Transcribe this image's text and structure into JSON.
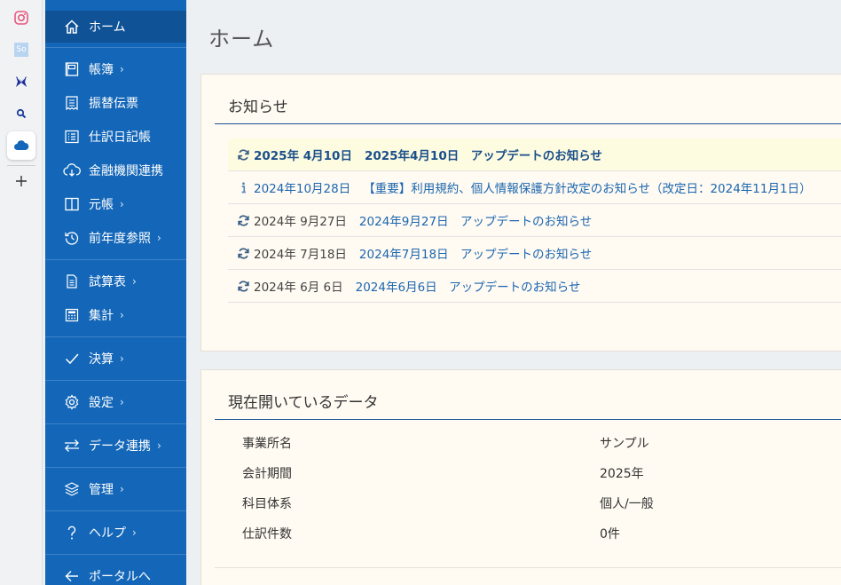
{
  "rail": {
    "items": [
      {
        "icon": "instagram-icon"
      },
      {
        "icon": "so-app-icon",
        "label": "So"
      },
      {
        "icon": "butterfly-icon"
      },
      {
        "icon": "search-icon"
      },
      {
        "icon": "cloud-icon"
      },
      {
        "icon": "plus-icon"
      }
    ]
  },
  "sidebar": {
    "items": [
      {
        "label": "ホーム",
        "icon": "home-icon",
        "chevron": ""
      },
      {
        "label": "帳簿",
        "icon": "ledger-icon",
        "chevron": "›"
      },
      {
        "label": "振替伝票",
        "icon": "receipt-icon",
        "chevron": ""
      },
      {
        "label": "仕訳日記帳",
        "icon": "journal-list-icon",
        "chevron": ""
      },
      {
        "label": "金融機関連携",
        "icon": "cloud-download-icon",
        "chevron": ""
      },
      {
        "label": "元帳",
        "icon": "book-icon",
        "chevron": "›"
      },
      {
        "label": "前年度参照",
        "icon": "history-icon",
        "chevron": "›"
      },
      {
        "label": "試算表",
        "icon": "document-icon",
        "chevron": "›"
      },
      {
        "label": "集計",
        "icon": "calculator-icon",
        "chevron": "›"
      },
      {
        "label": "決算",
        "icon": "check-icon",
        "chevron": "›"
      },
      {
        "label": "設定",
        "icon": "gear-icon",
        "chevron": "›"
      },
      {
        "label": "データ連携",
        "icon": "swap-icon",
        "chevron": "›"
      },
      {
        "label": "管理",
        "icon": "layers-icon",
        "chevron": "›"
      },
      {
        "label": "ヘルプ",
        "icon": "help-icon",
        "chevron": "›"
      },
      {
        "label": "ポータルへ",
        "icon": "arrow-left-icon",
        "chevron": ""
      }
    ]
  },
  "main": {
    "title": "ホーム",
    "news": {
      "title": "お知らせ",
      "items": [
        {
          "icon": "refresh-icon",
          "date": "2025年 4月10日",
          "text": "2025年4月10日　アップデートのお知らせ",
          "highlight": true
        },
        {
          "icon": "info-icon",
          "date": "2024年10月28日",
          "text": "【重要】利用規約、個人情報保護方針改定のお知らせ（改定日：2024年11月1日）",
          "highlight": false
        },
        {
          "icon": "refresh-icon",
          "date": "2024年 9月27日",
          "text": "2024年9月27日　アップデートのお知らせ",
          "highlight": false
        },
        {
          "icon": "refresh-icon",
          "date": "2024年 7月18日",
          "text": "2024年7月18日　アップデートのお知らせ",
          "highlight": false
        },
        {
          "icon": "refresh-icon",
          "date": "2024年 6月 6日",
          "text": "2024年6月6日　アップデートのお知らせ",
          "highlight": false
        }
      ]
    },
    "current_data": {
      "title": "現在開いているデータ",
      "rows": [
        {
          "key": "事業所名",
          "value": "サンプル"
        },
        {
          "key": "会計期間",
          "value": "2025年"
        },
        {
          "key": "科目体系",
          "value": "個人/一般"
        },
        {
          "key": "仕訳件数",
          "value": "0件"
        }
      ]
    }
  },
  "colors": {
    "sidebar": "#1467b8",
    "sidebar_active": "#0f5296",
    "link": "#1b67b0",
    "card_bg": "#fffaf2",
    "highlight_row": "#fdfce0"
  }
}
